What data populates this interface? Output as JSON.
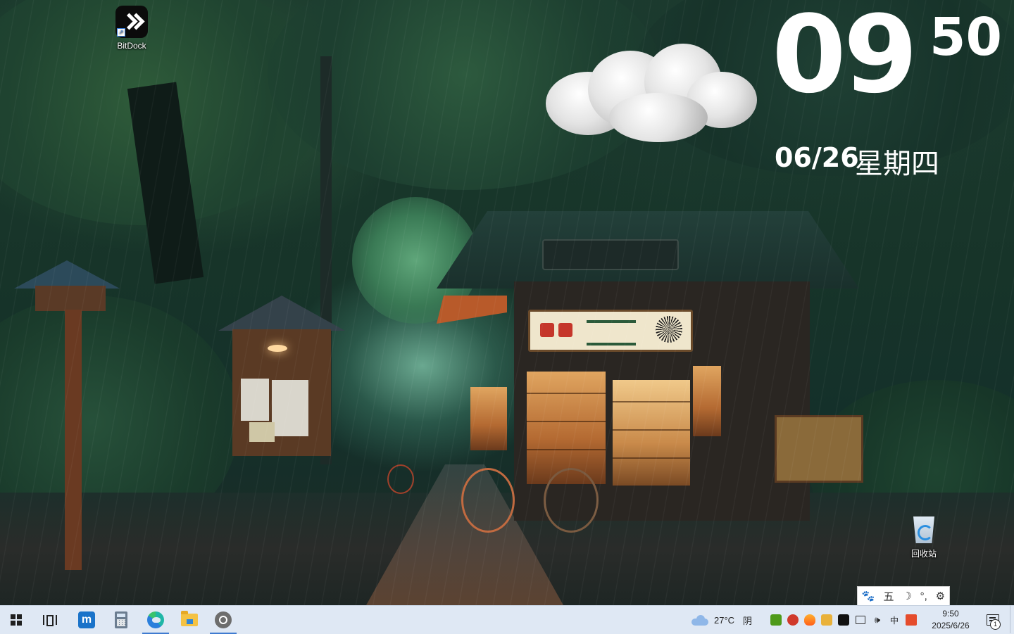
{
  "desktop": {
    "icons": [
      {
        "label": "BitDock",
        "icon": "bitdock-icon"
      },
      {
        "label": "回收站",
        "icon": "recycle-bin-icon"
      }
    ]
  },
  "clock_widget": {
    "hour": "09",
    "minute": "50",
    "date": "06/26",
    "weekday": "星期四",
    "weather_icon": "cloud-icon"
  },
  "ime_toolbar": {
    "logo_icon": "paw-icon",
    "mode": "五",
    "moon_icon": "moon-icon",
    "punct_icon": "punctuation-icon",
    "settings_icon": "gear-icon"
  },
  "taskbar": {
    "pinned": [
      {
        "name": "start",
        "icon": "windows-logo-icon"
      },
      {
        "name": "task-view",
        "icon": "task-view-icon"
      },
      {
        "name": "app",
        "icon": "m-app-icon",
        "glyph": "m"
      },
      {
        "name": "calculator",
        "icon": "calculator-icon"
      },
      {
        "name": "edge",
        "icon": "edge-icon",
        "active": true
      },
      {
        "name": "file-explorer",
        "icon": "folder-icon"
      },
      {
        "name": "app",
        "icon": "circle-app-icon",
        "active": true
      }
    ],
    "weather": {
      "temp": "27°C",
      "condition": "阴",
      "icon": "cloud-icon"
    },
    "tray": {
      "icons": [
        "nvidia-icon",
        "red-app-icon",
        "flame-icon",
        "card-icon",
        "bitdock-icon",
        "network-icon",
        "volume-icon",
        "ime-icon",
        "baidu-icon"
      ],
      "volume_glyph": "🕪",
      "ime_label": "中"
    },
    "clock": {
      "time": "9:50",
      "date": "2025/6/26"
    },
    "notifications": {
      "count": "1"
    }
  },
  "colors": {
    "taskbar_bg": "#dfe8f4",
    "accent": "#3f7bd0",
    "clock_text": "#ffffff"
  }
}
